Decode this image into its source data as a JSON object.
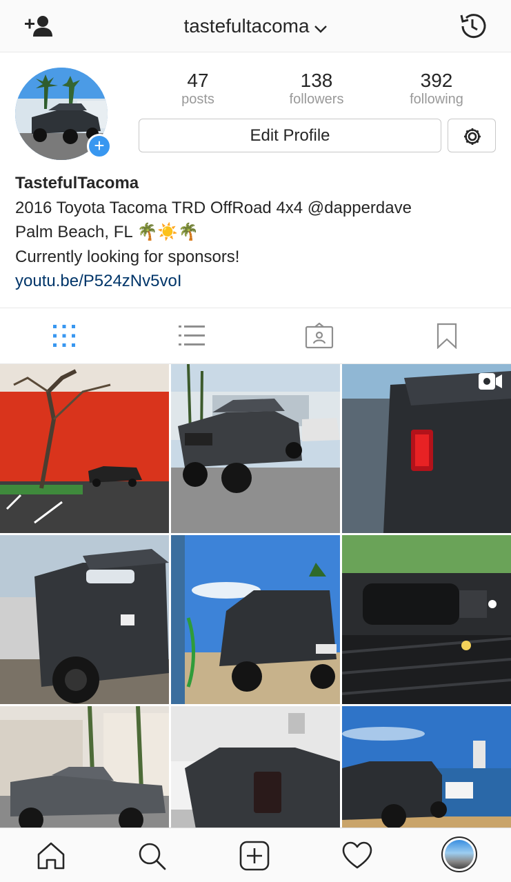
{
  "header": {
    "username": "tastefultacoma"
  },
  "profile": {
    "stats": [
      {
        "value": "47",
        "label": "posts"
      },
      {
        "value": "138",
        "label": "followers"
      },
      {
        "value": "392",
        "label": "following"
      }
    ],
    "edit_button": "Edit Profile",
    "bio": {
      "name": "TastefulTacoma",
      "line1": "2016 Toyota Tacoma TRD OffRoad 4x4 @dapperdave",
      "line2": "Palm Beach, FL 🌴☀️🌴",
      "line3": "Currently looking for sponsors!",
      "link": "youtu.be/P524zNv5voI"
    }
  },
  "tabs": [
    {
      "icon": "grid-icon",
      "active": true
    },
    {
      "icon": "list-icon",
      "active": false
    },
    {
      "icon": "tagged-icon",
      "active": false
    },
    {
      "icon": "bookmark-icon",
      "active": false
    }
  ],
  "posts": [
    {
      "subject": "red wall tree truck",
      "video": false
    },
    {
      "subject": "gray tacoma parking lot",
      "video": false
    },
    {
      "subject": "tail light close-up",
      "video": true
    },
    {
      "subject": "front headlight close-up",
      "video": false
    },
    {
      "subject": "gas station rear",
      "video": false
    },
    {
      "subject": "truck bed storage",
      "video": false
    },
    {
      "subject": "side profile building",
      "video": false
    },
    {
      "subject": "rear three-quarter",
      "video": false
    },
    {
      "subject": "waterfront sunset",
      "video": false
    }
  ],
  "bottom_nav": [
    "home-icon",
    "search-icon",
    "new-post-icon",
    "activity-heart-icon",
    "profile-avatar"
  ],
  "colors": {
    "accent_blue": "#3897f0",
    "link_blue": "#003569",
    "muted_gray": "#999999"
  }
}
